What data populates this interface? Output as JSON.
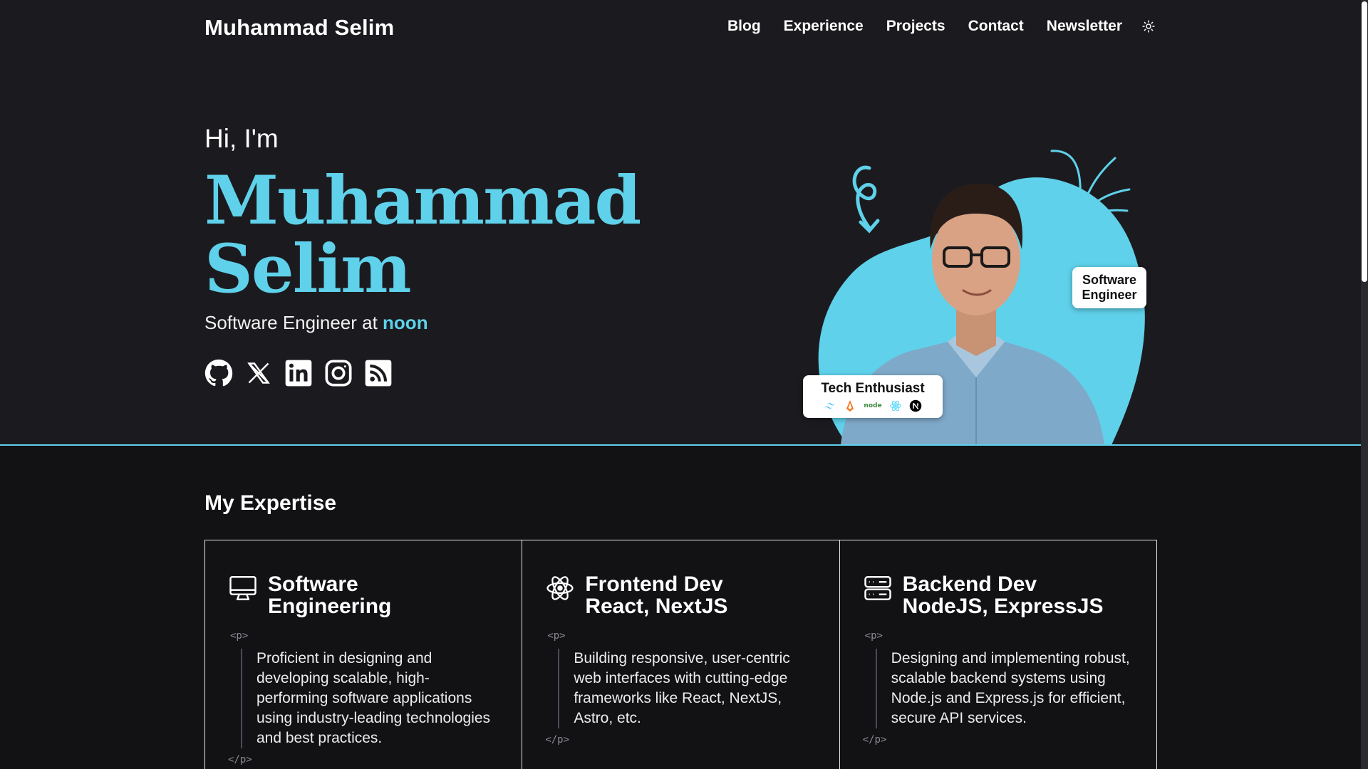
{
  "nav": {
    "brand": "Muhammad Selim",
    "links": [
      "Blog",
      "Experience",
      "Projects",
      "Contact",
      "Newsletter"
    ],
    "theme_icon": "sun-icon"
  },
  "hero": {
    "greeting": "Hi, I'm",
    "name_line1": "Muhammad",
    "name_line2": "Selim",
    "role_prefix": "Software Engineer at",
    "company": "noon",
    "socials": [
      "github-icon",
      "x-icon",
      "linkedin-icon",
      "instagram-icon",
      "rss-icon"
    ],
    "badge_role_line1": "Software",
    "badge_role_line2": "Engineer",
    "badge_tech": "Tech Enthusiast",
    "tech_icons": [
      "tailwind-icon",
      "svelte-icon",
      "node-icon",
      "react-icon",
      "nextjs-icon"
    ],
    "accent": "#5fd1ea"
  },
  "expertise": {
    "title": "My Expertise",
    "cards": [
      {
        "title_line1": "Software",
        "title_line2": "Engineering",
        "tag_open": "<p>",
        "body": "Proficient in designing and developing scalable, high-performing software applications using industry-leading technologies and best practices.",
        "tag_close": "</p>",
        "icon": "monitor-icon",
        "highlight": "#e93d82"
      },
      {
        "title_line1": "Frontend Dev",
        "title_line2": "React, NextJS",
        "tag_open": "<p>",
        "body": "Building responsive, user-centric web interfaces with cutting-edge frameworks like React, NextJS, Astro, etc.",
        "tag_close": "</p>",
        "icon": "atom-icon",
        "highlight": "#3b6ff0"
      },
      {
        "title_line1": "Backend Dev",
        "title_line2": "NodeJS, ExpressJS",
        "tag_open": "<p>",
        "body": "Designing and implementing robust, scalable backend systems using Node.js and Express.js for efficient, secure API services.",
        "tag_close": "</p>",
        "icon": "server-icon",
        "highlight": "#27b566"
      }
    ]
  }
}
